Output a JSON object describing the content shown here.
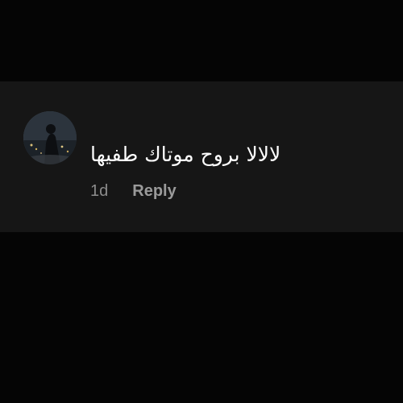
{
  "comment": {
    "text": "لالالا بروح موتاك طفيها",
    "timestamp": "1d",
    "reply_label": "Reply"
  },
  "colors": {
    "background": "#050505",
    "card": "#161616",
    "text": "#ffffff",
    "muted": "#8c8c8c"
  },
  "icons": {
    "avatar": "user-avatar-photo"
  }
}
